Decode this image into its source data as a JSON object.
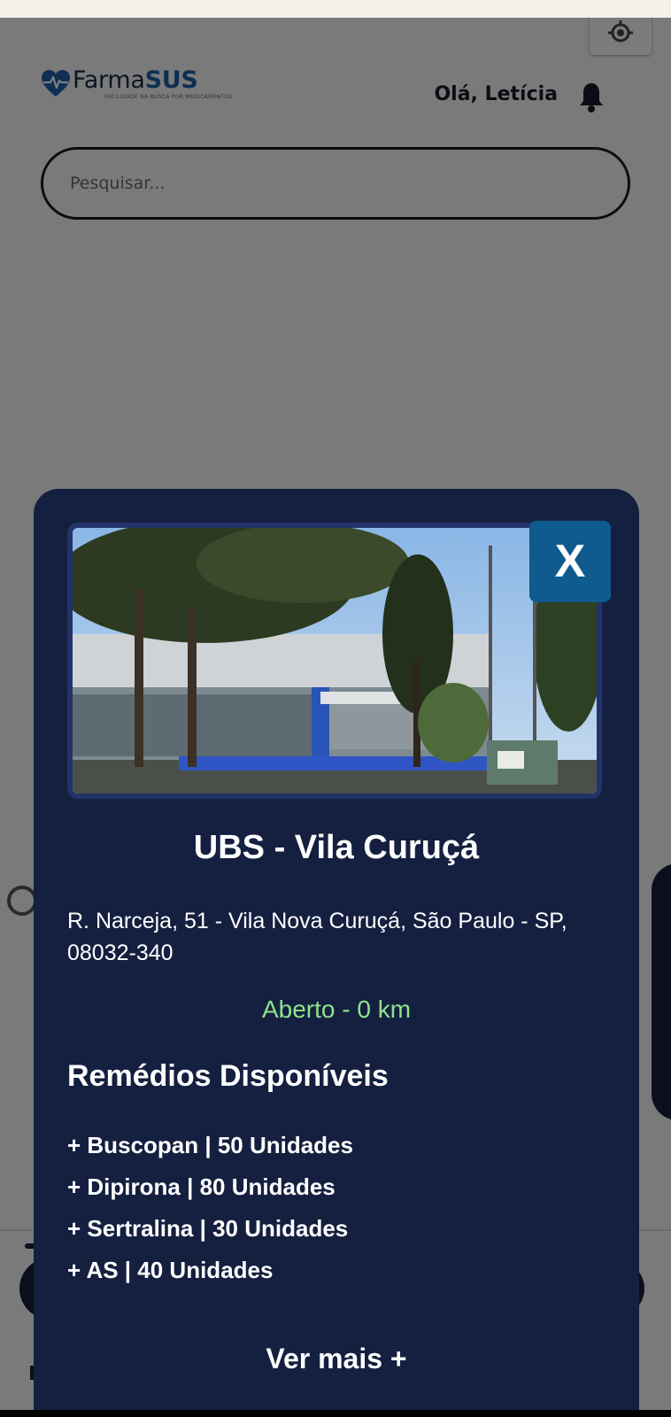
{
  "header": {
    "logo": {
      "brand_part1": "Farma",
      "brand_part2": "SUS",
      "tagline": "FACILIDADE NA BUSCA POR MEDICAMENTOS"
    },
    "greeting": "Olá, Letícia"
  },
  "search": {
    "placeholder": "Pesquisar...",
    "value": ""
  },
  "modal": {
    "title": "UBS - Vila Curuçá",
    "address": "R. Narceja, 51 - Vila Nova Curuçá, São Paulo - SP, 08032-340",
    "status": "Aberto - 0 km",
    "close_label": "X",
    "medicines_title": "Remédios Disponíveis",
    "medicines": [
      "+ Buscopan | 50 Unidades",
      "+ Dipirona | 80 Unidades",
      "+ Sertralina | 30 Unidades",
      "+ AS | 40 Unidades"
    ],
    "see_more": "Ver mais +"
  },
  "colors": {
    "modal_bg": "#152040",
    "accent_blue": "#0f5a8e",
    "status_green": "#8fe38a",
    "brand_dark": "#1a2a44",
    "brand_blue": "#1e5fa8"
  }
}
